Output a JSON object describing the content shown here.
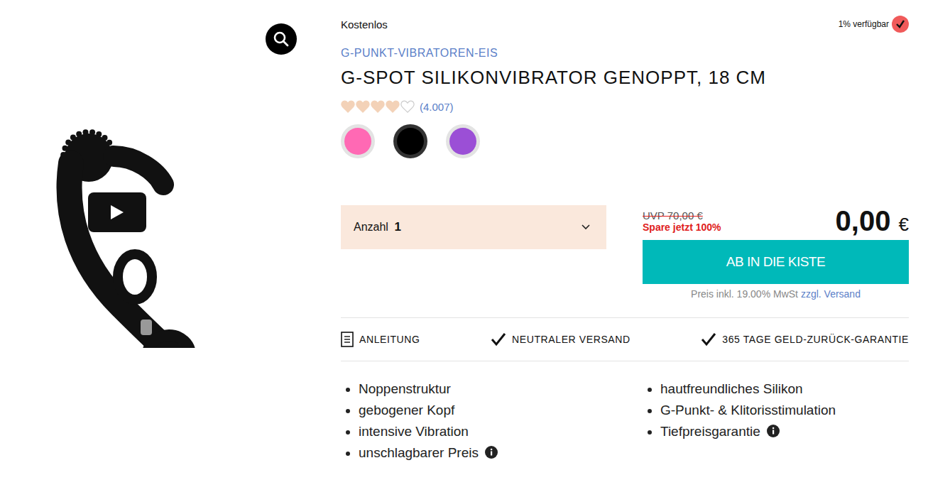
{
  "badge": "Kostenlos",
  "availability": {
    "text": "1% verfügbar",
    "available": true
  },
  "category": {
    "main": "G-PUNKT-VIBRATOREN",
    "separator": "-",
    "sub": "EIS"
  },
  "title": "G-SPOT SILIKONVIBRATOR GENOPPT, 18 CM",
  "rating": {
    "stars": 4,
    "max": 5,
    "count": "(4.007)"
  },
  "colors": [
    {
      "color": "#ff69b4",
      "selected": false
    },
    {
      "color": "#000000",
      "selected": true
    },
    {
      "color": "#9b4fd6",
      "selected": false
    }
  ],
  "quantity": {
    "label": "Anzahl",
    "value": "1"
  },
  "price": {
    "uvp": "UVP 70,00 €",
    "savings": "Spare jetzt 100%",
    "amount": "0,00",
    "currency": "€"
  },
  "cart_button": "AB IN DIE KISTE",
  "tax_note": {
    "text": "Preis inkl. 19.00% MwSt",
    "link": "zzgl. Versand"
  },
  "features": [
    {
      "label": "ANLEITUNG",
      "kind": "document"
    },
    {
      "label": "NEUTRALER VERSAND",
      "kind": "check"
    },
    {
      "label": "365 TAGE GELD-ZURÜCK-GARANTIE",
      "kind": "check"
    }
  ],
  "bullets_left": [
    {
      "text": "Noppenstruktur",
      "info": false
    },
    {
      "text": "gebogener Kopf",
      "info": false
    },
    {
      "text": "intensive Vibration",
      "info": false
    },
    {
      "text": "unschlagbarer Preis",
      "info": true
    }
  ],
  "bullets_right": [
    {
      "text": "hautfreundliches Silikon",
      "info": false
    },
    {
      "text": "G-Punkt- & Klitorisstimulation",
      "info": false
    },
    {
      "text": "Tiefpreisgarantie",
      "info": true
    }
  ]
}
